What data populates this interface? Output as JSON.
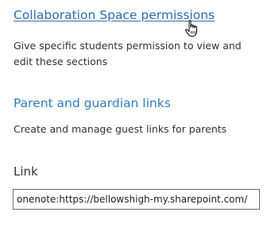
{
  "collaboration": {
    "link_label": "Collaboration Space permissions",
    "description": "Give specific students permission to view and edit these sections"
  },
  "guardian": {
    "link_label": "Parent and guardian links",
    "description": "Create and manage guest links for parents"
  },
  "link_field": {
    "label": "Link",
    "value": "onenote:https://bellowshigh-my.sharepoint.com/"
  },
  "cursor": {
    "icon": "hand-pointer-icon"
  },
  "colors": {
    "link": "#2b6cb0",
    "text": "#333333"
  }
}
